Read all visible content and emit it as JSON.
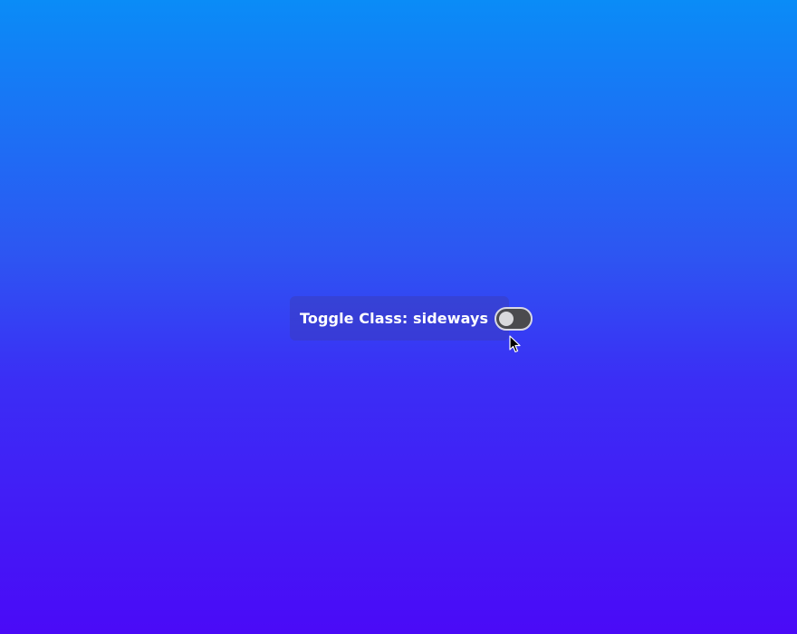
{
  "toggle": {
    "label": "Toggle Class: sideways",
    "checked": false
  },
  "icons": {
    "cursor": "mouse-pointer-icon"
  },
  "colors": {
    "background_top": "#0a8cf7",
    "background_bottom": "#4a0af7",
    "switch_track": "#4b4b4e",
    "switch_knob": "#d9d9dc"
  }
}
